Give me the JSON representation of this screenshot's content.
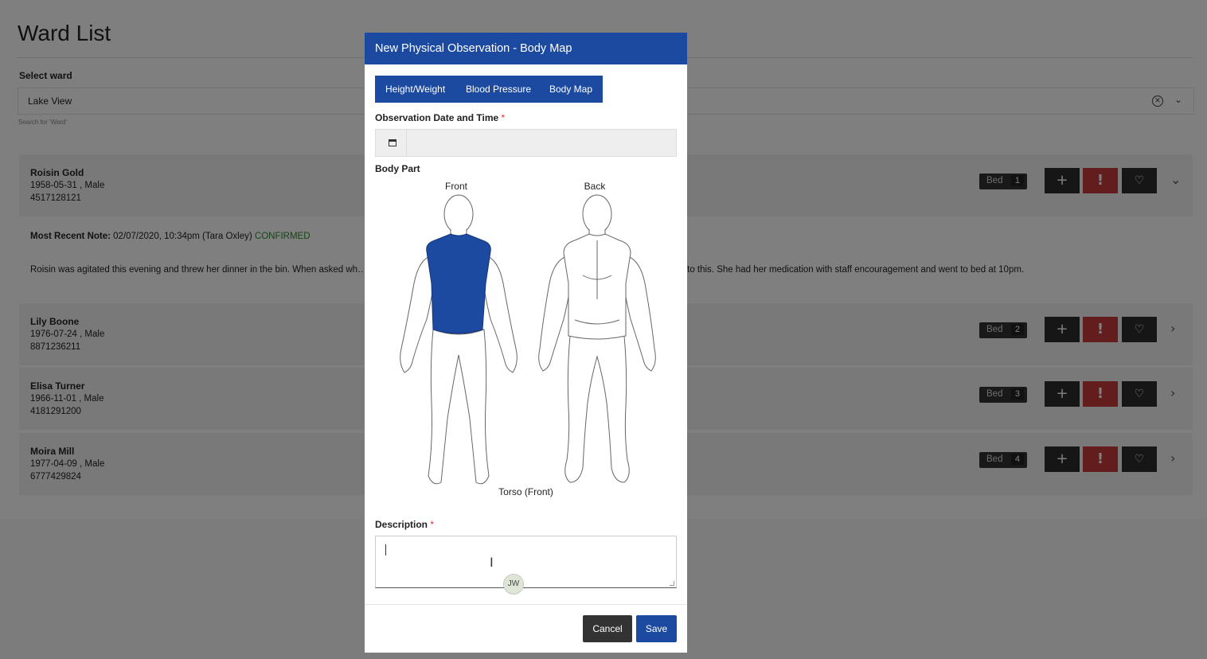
{
  "page": {
    "title": "Ward List",
    "select_label": "Select ward",
    "selected_ward": "Lake View",
    "select_hint": "Search for 'Ward'",
    "clear_glyph": "✕",
    "caret_glyph": "⌄"
  },
  "patients": [
    {
      "name": "Roisin Gold",
      "dob_sex": "1958-05-31 , Male",
      "id": "4517128121",
      "bed_label": "Bed",
      "bed": "1",
      "chevron": "⌄"
    },
    {
      "name": "Lily Boone",
      "dob_sex": "1976-07-24 , Male",
      "id": "8871236211",
      "bed_label": "Bed",
      "bed": "2",
      "chevron": "›"
    },
    {
      "name": "Elisa Turner",
      "dob_sex": "1966-11-01 , Male",
      "id": "4181291200",
      "bed_label": "Bed",
      "bed": "3",
      "chevron": "›"
    },
    {
      "name": "Moira Mill",
      "dob_sex": "1977-04-09 , Male",
      "id": "6777429824",
      "bed_label": "Bed",
      "bed": "4",
      "chevron": "›"
    }
  ],
  "actions": {
    "add": "+",
    "alert": "!",
    "heart": "♡"
  },
  "recent_note": {
    "label": "Most Recent Note:",
    "meta": "02/07/2020, 10:34pm (Tara Oxley)",
    "status": "CONFIRMED",
    "status_color": "#2e8b2e",
    "text": "Roisin was agitated this evening and threw her dinner in the bin. When asked wh… aff and then running to her room. Roisin had been quiet all evening leading up to this. She had her medication with staff encouragement and went to bed at 10pm."
  },
  "modal": {
    "title": "New Physical Observation - Body Map",
    "tabs": [
      "Height/Weight",
      "Blood Pressure",
      "Body Map"
    ],
    "date_label": "Observation Date and Time",
    "required_mark": "*",
    "date_value": "",
    "body_part_label": "Body Part",
    "front_label": "Front",
    "back_label": "Back",
    "selected_part": "Torso (Front)",
    "description_label": "Description",
    "description_value": "",
    "avatar_initials": "JW",
    "cancel_label": "Cancel",
    "save_label": "Save",
    "accent_color": "#1c4aa0"
  }
}
